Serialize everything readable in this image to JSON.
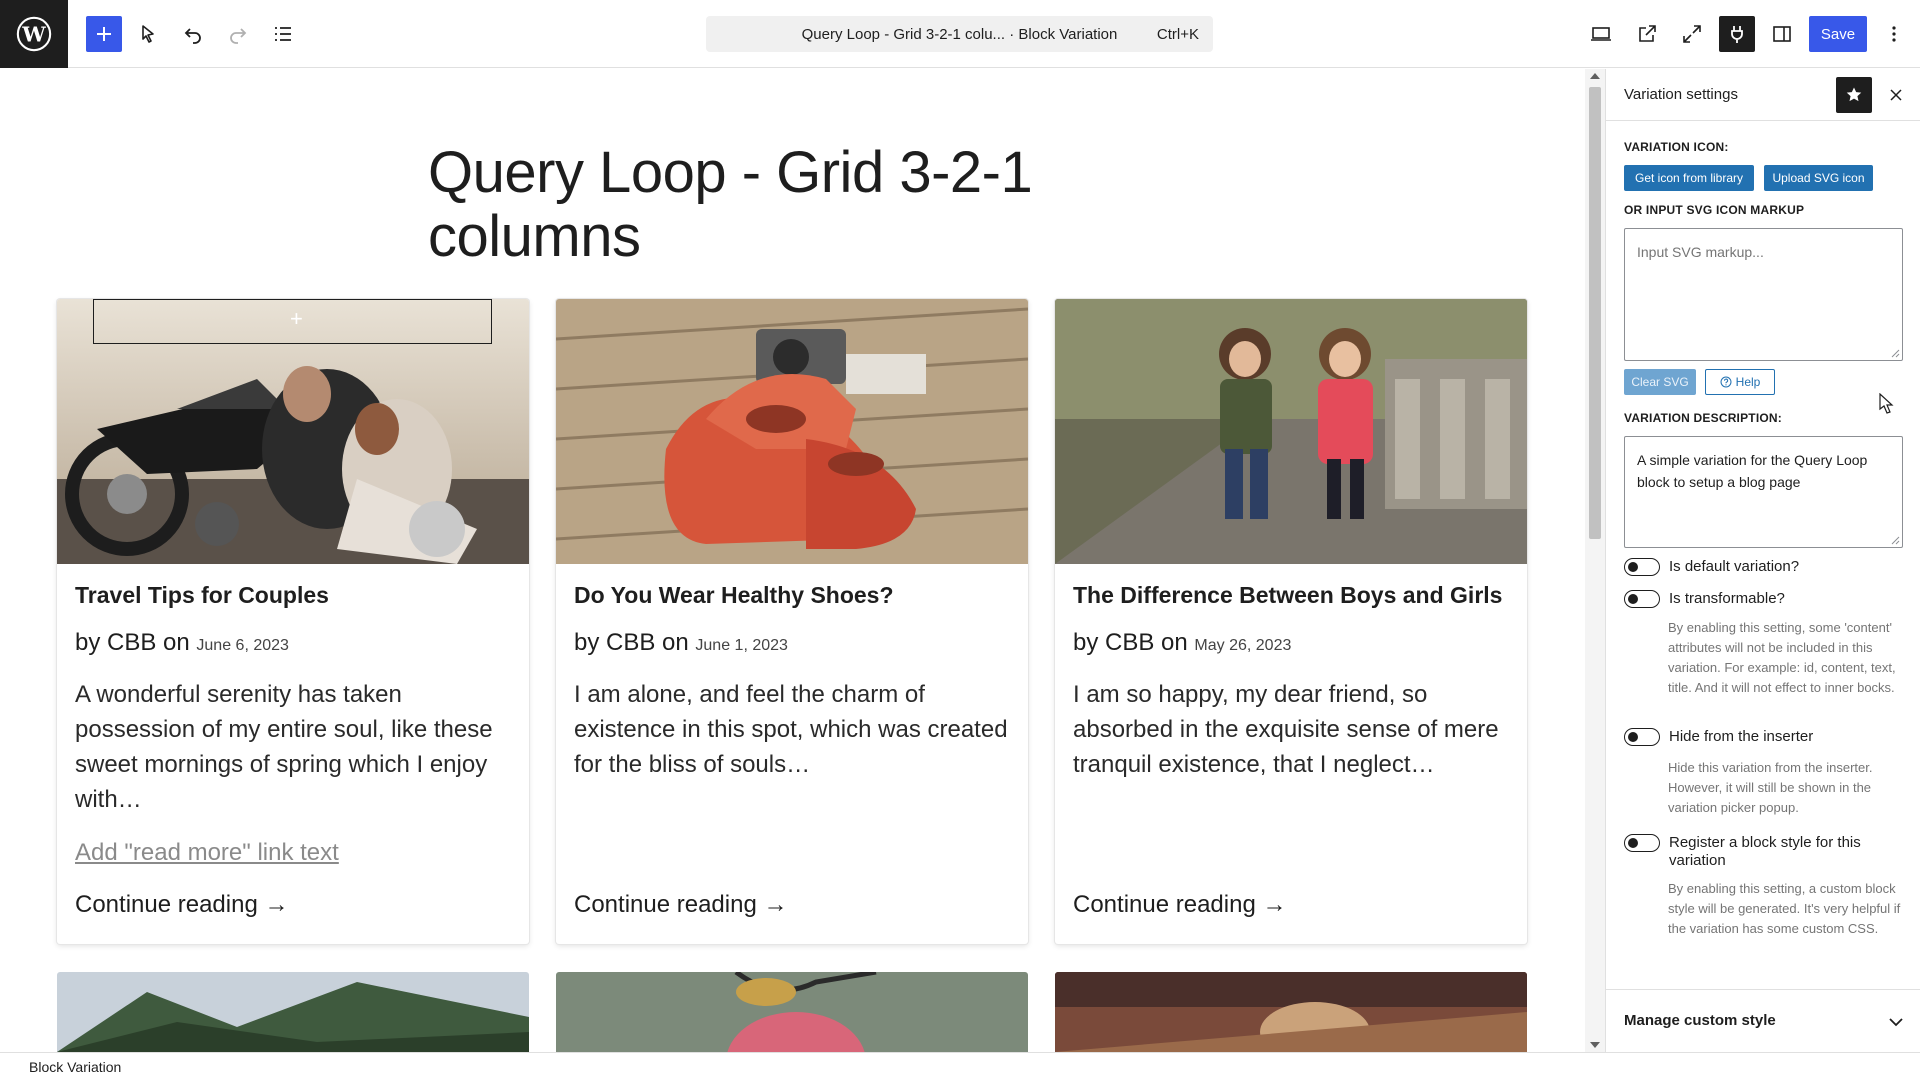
{
  "toolbar": {
    "document_title": "Query Loop - Grid 3-2-1 colu...",
    "document_separator": " · ",
    "document_type": "Block Variation",
    "shortcut": "Ctrl+K",
    "save_label": "Save"
  },
  "canvas": {
    "page_title": "Query Loop - Grid 3-2-1 columns",
    "posts": [
      {
        "title": "Travel Tips for Couples",
        "by_prefix": "by CBB on",
        "date": "June 6, 2023",
        "excerpt": "A wonderful serenity has taken possession of my entire soul, like these sweet mornings of spring which I enjoy with…",
        "read_more": "Add \"read more\" link text",
        "continue": "Continue reading →"
      },
      {
        "title": "Do You Wear Healthy Shoes?",
        "by_prefix": "by CBB on",
        "date": "June 1, 2023",
        "excerpt": "I am alone, and feel the charm of existence in this spot, which was created for the bliss of souls…",
        "continue": "Continue reading →"
      },
      {
        "title": "The Difference Between Boys and Girls",
        "by_prefix": "by CBB on",
        "date": "May 26, 2023",
        "excerpt": "I am so happy, my dear friend, so absorbed in the exquisite sense of mere tranquil existence, that I neglect…",
        "continue": "Continue reading →"
      }
    ]
  },
  "sidebar": {
    "title": "Variation settings",
    "variation_icon_label": "VARIATION ICON:",
    "get_icon_button": "Get icon from library",
    "upload_svg_button": "Upload SVG icon",
    "svg_markup_label": "OR INPUT SVG ICON MARKUP",
    "svg_placeholder": "Input SVG markup...",
    "clear_svg_button": "Clear SVG",
    "help_button": "Help",
    "description_label": "VARIATION DESCRIPTION:",
    "description_value": "A simple variation for the Query Loop block to setup a blog page",
    "toggles": [
      {
        "label": "Is default variation?",
        "checked": false
      },
      {
        "label": "Is transformable?",
        "checked": false,
        "help": "By enabling this setting, some 'content' attributes will not be included in this variation. For example: id, content, text, title. And it will not effect to inner bocks."
      },
      {
        "label": "Hide from the inserter",
        "checked": false,
        "help": "Hide this variation from the inserter. However, it will still be shown in the variation picker popup."
      },
      {
        "label": "Register a block style for this variation",
        "checked": false,
        "help": "By enabling this setting, a custom block style will be generated. It's very helpful if the variation has some custom CSS."
      }
    ],
    "manage_custom_style": "Manage custom style"
  },
  "footer": {
    "breadcrumb": "Block Variation"
  },
  "colors": {
    "accent": "#3858e9",
    "wp_blue": "#2271b1",
    "dark": "#1e1e1e"
  }
}
